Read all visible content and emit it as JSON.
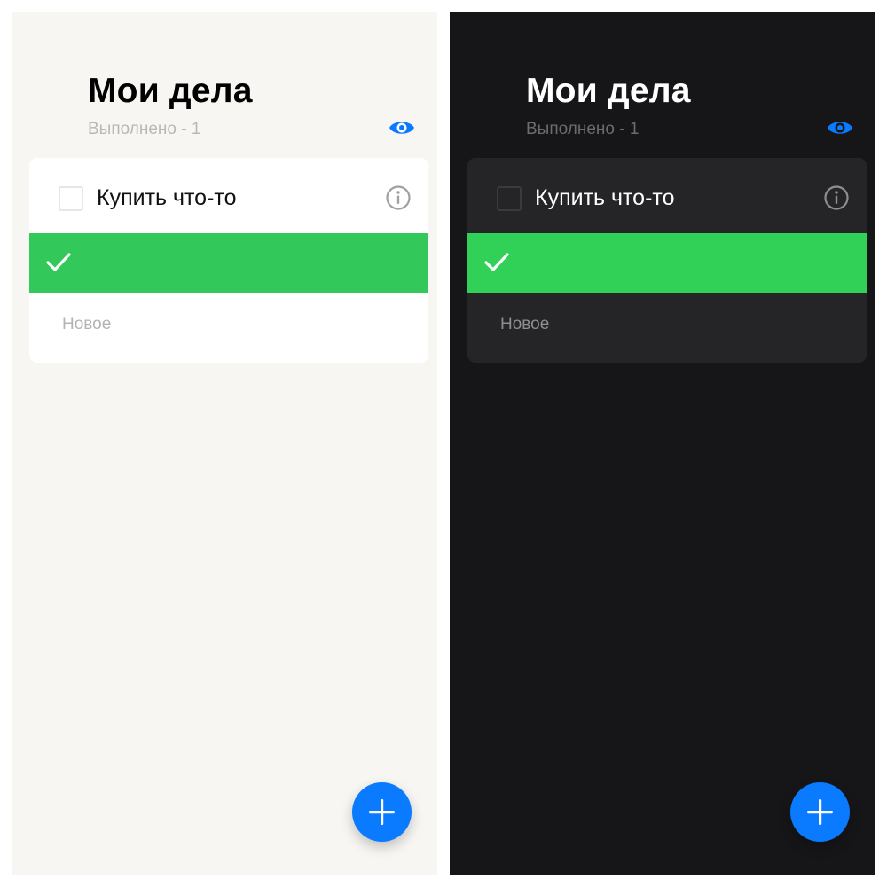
{
  "light": {
    "title": "Мои дела",
    "done_count_text": "Выполнено - 1",
    "tasks": [
      {
        "text": "Купить что-то",
        "done": false
      }
    ],
    "new_item_placeholder": "Новое"
  },
  "dark": {
    "title": "Мои дела",
    "done_count_text": "Выполнено - 1",
    "tasks": [
      {
        "text": "Купить что-то",
        "done": false
      }
    ],
    "new_item_placeholder": "Новое"
  },
  "icons": {
    "visibility": "eye-icon",
    "info": "info-icon",
    "complete": "checkmark-icon",
    "add": "plus-icon"
  },
  "colors": {
    "accent_blue": "#0a7aff",
    "swipe_green_light": "#33c85a",
    "swipe_green_dark": "#31d158",
    "bg_light": "#f7f6f2",
    "bg_dark": "#161618"
  }
}
